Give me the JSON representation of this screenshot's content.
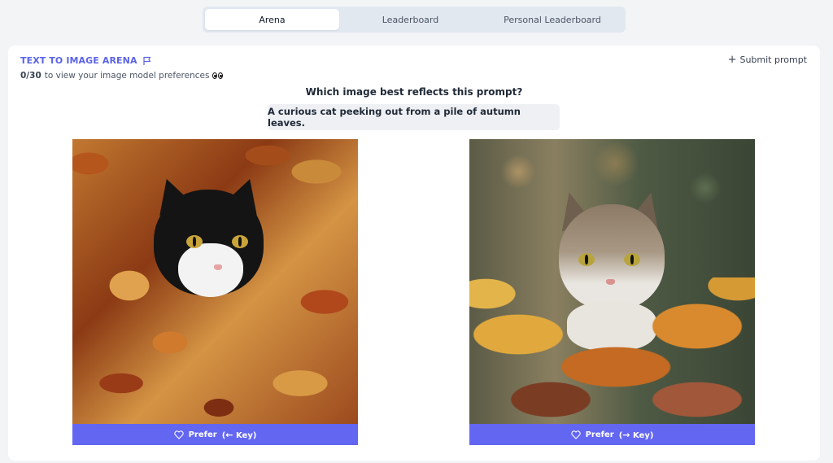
{
  "tabs": [
    {
      "label": "Arena",
      "active": true
    },
    {
      "label": "Leaderboard",
      "active": false
    },
    {
      "label": "Personal Leaderboard",
      "active": false
    }
  ],
  "arena": {
    "title": "TEXT TO IMAGE ARENA",
    "progress_count": "0/30",
    "progress_text": "to view your image model preferences",
    "submit_label": "Submit prompt",
    "question": "Which image best reflects this prompt?",
    "prompt": "A curious cat peeking out from a pile of autumn leaves."
  },
  "options": [
    {
      "prefer_label": "Prefer",
      "key_hint": "Key",
      "arrow": "←"
    },
    {
      "prefer_label": "Prefer",
      "key_hint": "Key",
      "arrow": "→"
    }
  ],
  "colors": {
    "accent": "#6366f1",
    "title_accent": "#5b63e6"
  }
}
